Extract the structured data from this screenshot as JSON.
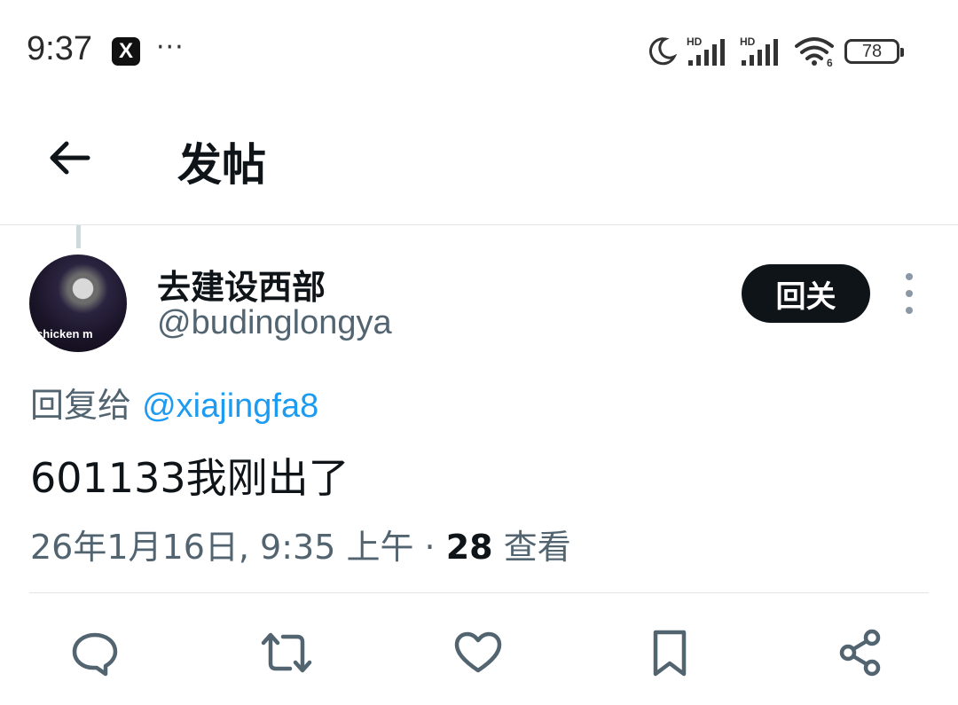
{
  "status_bar": {
    "time": "9:37",
    "app_badge": "X",
    "more_indicator": "···",
    "signal_labels": [
      "HD",
      "HD"
    ],
    "wifi_label": "6",
    "battery": "78"
  },
  "header": {
    "title": "发帖"
  },
  "post": {
    "author": {
      "display_name": "去建设西部",
      "handle": "@budinglongya",
      "avatar_caption": "chicken m"
    },
    "follow_button": "回关",
    "reply_to": {
      "prefix": "回复给",
      "user": "@xiajingfa8"
    },
    "text": "601133我刚出了",
    "timestamp": "26年1月16日, 9:35 上午",
    "separator": " · ",
    "views_count": "28",
    "views_label": "查看"
  },
  "actions": [
    {
      "name": "reply",
      "icon": "speech-bubble-icon"
    },
    {
      "name": "repost",
      "icon": "repost-icon"
    },
    {
      "name": "like",
      "icon": "heart-icon"
    },
    {
      "name": "bookmark",
      "icon": "bookmark-icon"
    },
    {
      "name": "share",
      "icon": "share-icon"
    }
  ],
  "colors": {
    "text_primary": "#0f1419",
    "text_secondary": "#536471",
    "link": "#1d9bf0",
    "button_bg": "#0f1419",
    "divider": "#e1e5e8"
  }
}
